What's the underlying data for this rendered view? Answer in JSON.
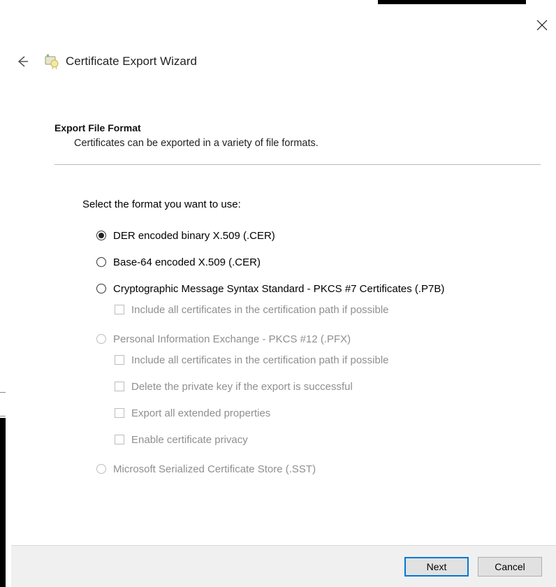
{
  "title": "Certificate Export Wizard",
  "section": {
    "title": "Export File Format",
    "subtitle": "Certificates can be exported in a variety of file formats."
  },
  "prompt": "Select the format you want to use:",
  "options": {
    "der": {
      "label": "DER encoded binary X.509 (.CER)",
      "selected": true,
      "enabled": true
    },
    "base64": {
      "label": "Base-64 encoded X.509 (.CER)",
      "selected": false,
      "enabled": true
    },
    "p7b": {
      "label": "Cryptographic Message Syntax Standard - PKCS #7 Certificates (.P7B)",
      "selected": false,
      "enabled": true,
      "sub": {
        "include_chain": {
          "label": "Include all certificates in the certification path if possible",
          "enabled": false,
          "checked": false
        }
      }
    },
    "pfx": {
      "label": "Personal Information Exchange - PKCS #12 (.PFX)",
      "selected": false,
      "enabled": false,
      "sub": {
        "include_chain": {
          "label": "Include all certificates in the certification path if possible",
          "enabled": false,
          "checked": false
        },
        "delete_key": {
          "label": "Delete the private key if the export is successful",
          "enabled": false,
          "checked": false
        },
        "ext_props": {
          "label": "Export all extended properties",
          "enabled": false,
          "checked": false
        },
        "cert_privacy": {
          "label": "Enable certificate privacy",
          "enabled": false,
          "checked": false
        }
      }
    },
    "sst": {
      "label": "Microsoft Serialized Certificate Store (.SST)",
      "selected": false,
      "enabled": false
    }
  },
  "buttons": {
    "next": "Next",
    "cancel": "Cancel"
  }
}
